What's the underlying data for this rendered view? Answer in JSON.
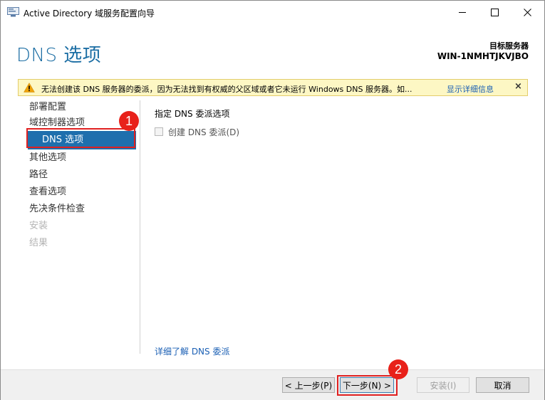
{
  "window": {
    "title": "Active Directory 域服务配置向导",
    "controls": {
      "minimize": "minimize",
      "maximize": "maximize",
      "close": "close"
    }
  },
  "header": {
    "page_title": "DNS 选项",
    "target_label": "目标服务器",
    "target_name": "WIN-1NMHTJKVJBO"
  },
  "warning": {
    "icon": "warning-triangle-icon",
    "text": "无法创建该 DNS 服务器的委派，因为无法找到有权威的父区域或者它未运行 Windows DNS 服务器。如...",
    "link": "显示详细信息",
    "close": "×"
  },
  "nav": {
    "items": [
      {
        "label": "部署配置",
        "state": "normal"
      },
      {
        "label": "域控制器选项",
        "state": "normal"
      },
      {
        "label": "DNS 选项",
        "state": "selected"
      },
      {
        "label": "其他选项",
        "state": "normal"
      },
      {
        "label": "路径",
        "state": "normal"
      },
      {
        "label": "查看选项",
        "state": "normal"
      },
      {
        "label": "先决条件检查",
        "state": "normal"
      },
      {
        "label": "安装",
        "state": "disabled"
      },
      {
        "label": "结果",
        "state": "disabled"
      }
    ]
  },
  "content": {
    "heading": "指定 DNS 委派选项",
    "checkbox_label": "创建 DNS 委派(D)",
    "checkbox_checked": false,
    "learn_more": "详细了解 DNS 委派"
  },
  "footer": {
    "prev": "< 上一步(P)",
    "next": "下一步(N) >",
    "install": "安装(I)",
    "cancel": "取消"
  },
  "annotations": {
    "badge1": "1",
    "badge2": "2",
    "color": "#e8211a"
  },
  "colors": {
    "accent": "#1e6fad",
    "title_blue": "#1c6ea4",
    "link": "#1a5fb4",
    "warning_bg": "#fdf7c4"
  }
}
